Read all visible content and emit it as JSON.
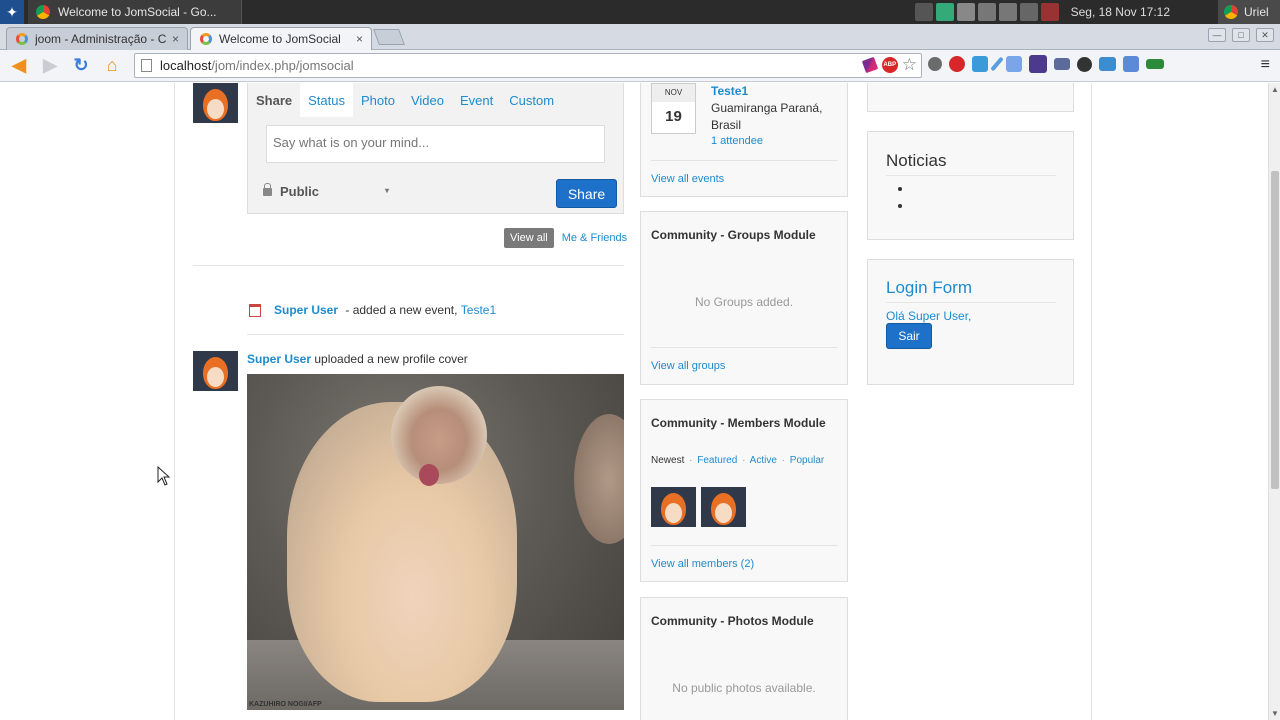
{
  "os": {
    "window_title": "Welcome to JomSocial - Go...",
    "clock": "Seg, 18 Nov  17:12",
    "user_window": "Uriel"
  },
  "browser": {
    "tabs": [
      {
        "title": "joom - Administração - Co",
        "close": "×"
      },
      {
        "title": "Welcome to JomSocial",
        "close": "×"
      }
    ],
    "url_host": "localhost",
    "url_path": "/jom/index.php/jomsocial",
    "star": "☆",
    "menu": "≡",
    "abp": "ABP"
  },
  "stream": {
    "share": {
      "label": "Share",
      "tabs": [
        "Status",
        "Photo",
        "Video",
        "Event",
        "Custom"
      ],
      "placeholder": "Say what is on your mind...",
      "privacy": "Public",
      "caret": "▾",
      "button": "Share"
    },
    "filters": {
      "view_all": "View all",
      "me_friends": "Me & Friends"
    },
    "activities": [
      {
        "user": "Super User",
        "text": " - added a new event, ",
        "target": "Teste1"
      },
      {
        "user": "Super User",
        "text": " uploaded a new profile cover",
        "photo_credit": "KAZUHIRO NOGI/AFP"
      }
    ]
  },
  "events_module": {
    "event": {
      "month": "NOV",
      "day": "19",
      "title": "Teste1",
      "location": "Guamiranga Paraná, Brasil",
      "attendees": "1 attendee"
    },
    "footer": "View all events"
  },
  "groups_module": {
    "title": "Community - Groups Module",
    "empty": "No Groups added.",
    "footer": "View all groups"
  },
  "members_module": {
    "title": "Community - Members Module",
    "tabs": {
      "newest": "Newest",
      "featured": "Featured",
      "active": "Active",
      "popular": "Popular",
      "sep": "·"
    },
    "footer": "View all members (2)"
  },
  "photos_module": {
    "title": "Community - Photos Module",
    "empty": "No public photos available."
  },
  "news_module": {
    "title": "Noticias"
  },
  "login_module": {
    "title": "Login Form",
    "greeting": "Olá Super User,",
    "button": "Sair"
  },
  "colors": {
    "link": "#1e8bcd",
    "button": "#1d71c9",
    "os_bar": "#2b2b2b"
  }
}
